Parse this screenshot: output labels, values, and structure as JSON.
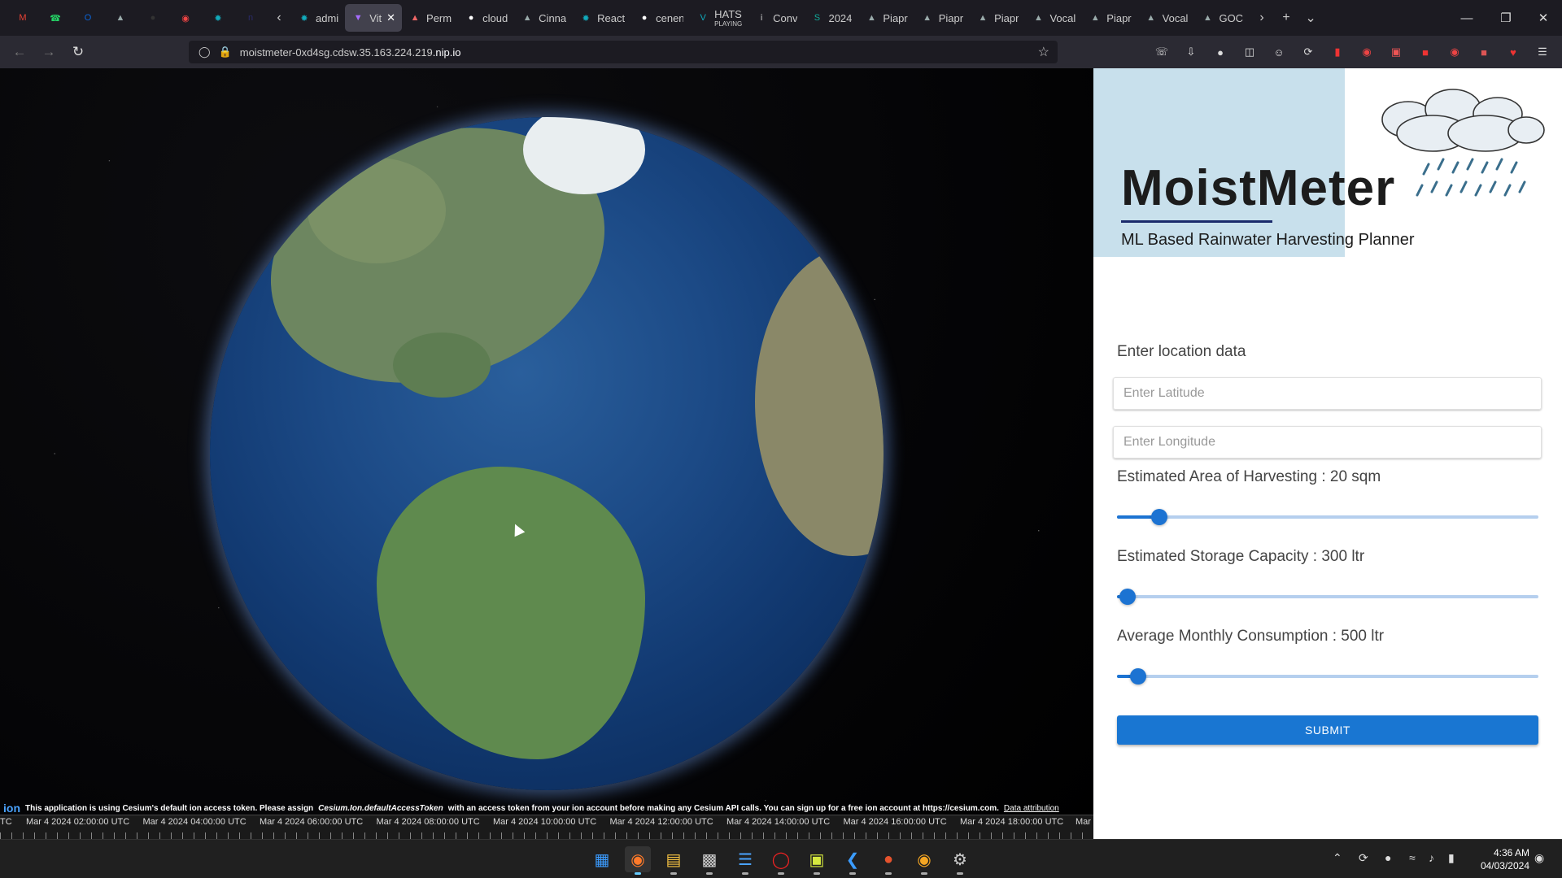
{
  "browser": {
    "tabs": [
      {
        "label": "",
        "icon": "gmail-icon",
        "color": "#ea4335"
      },
      {
        "label": "",
        "icon": "whatsapp-icon",
        "color": "#25d366"
      },
      {
        "label": "",
        "icon": "outlook-icon",
        "color": "#0a64d8"
      },
      {
        "label": "",
        "icon": "bird-icon",
        "color": "#9aa"
      },
      {
        "label": "",
        "icon": "circle-icon",
        "color": "#333"
      },
      {
        "label": "",
        "icon": "chrome-icon",
        "color": "#e44"
      },
      {
        "label": "",
        "icon": "react-icon",
        "color": "#1ab"
      },
      {
        "label": "",
        "icon": "n-icon",
        "color": "#2a2a6a"
      },
      {
        "label": "admi",
        "icon": "react-icon",
        "color": "#1ab"
      },
      {
        "label": "Vit",
        "icon": "vite-icon",
        "color": "#a66cff"
      },
      {
        "label": "Perm",
        "icon": "fire-icon",
        "color": "#e66"
      },
      {
        "label": "cloud",
        "icon": "github-icon",
        "color": "#fff"
      },
      {
        "label": "Cinna",
        "icon": "bird-icon",
        "color": "#9aa"
      },
      {
        "label": "React",
        "icon": "react-icon",
        "color": "#1ab"
      },
      {
        "label": "cenen",
        "icon": "github-icon",
        "color": "#fff"
      },
      {
        "label": "HATS",
        "sublabel": "PLAYING",
        "icon": "vimeo-icon",
        "color": "#1ab"
      },
      {
        "label": "Conv",
        "icon": "info-icon",
        "color": "#ccc"
      },
      {
        "label": "2024",
        "icon": "s-icon",
        "color": "#1a9"
      },
      {
        "label": "Piapr",
        "icon": "bird-icon",
        "color": "#9aa"
      },
      {
        "label": "Piapr",
        "icon": "bird-icon",
        "color": "#9aa"
      },
      {
        "label": "Piapr",
        "icon": "bird-icon",
        "color": "#9aa"
      },
      {
        "label": "Vocal",
        "icon": "bird-icon",
        "color": "#9aa"
      },
      {
        "label": "Piapr",
        "icon": "bird-icon",
        "color": "#9aa"
      },
      {
        "label": "Vocal",
        "icon": "bird-icon",
        "color": "#9aa"
      },
      {
        "label": "GOC",
        "icon": "bird-icon",
        "color": "#9aa"
      }
    ],
    "url_path": "moistmeter-0xd4sg.cdsw.35.163.224.219",
    "url_host": ".nip.io"
  },
  "cesium": {
    "credit_text": "This application is using Cesium's default ion access token. Please assign",
    "credit_code": "Cesium.Ion.defaultAccessToken",
    "credit_text2": "with an access token from your ion account before making any Cesium API calls. You can sign up for a free ion account at https://cesium.com.",
    "credit_link": "Data attribution",
    "ion_label": "ion",
    "timeline_start": "TC",
    "timeline_end": "Mar",
    "timeline_labels": [
      "Mar 4 2024 02:00:00 UTC",
      "Mar 4 2024 04:00:00 UTC",
      "Mar 4 2024 06:00:00 UTC",
      "Mar 4 2024 08:00:00 UTC",
      "Mar 4 2024 10:00:00 UTC",
      "Mar 4 2024 12:00:00 UTC",
      "Mar 4 2024 14:00:00 UTC",
      "Mar 4 2024 16:00:00 UTC",
      "Mar 4 2024 18:00:00 UTC"
    ]
  },
  "panel": {
    "title": "MoistMeter",
    "subtitle": "ML Based Rainwater Harvesting Planner",
    "form_label": "Enter location data",
    "latitude_placeholder": "Enter Latitude",
    "longitude_placeholder": "Enter Longitude",
    "area_label": "Estimated Area of Harvesting : 20 sqm",
    "area_fraction": 0.1,
    "storage_label": "Estimated Storage Capacity : 300 ltr",
    "storage_fraction": 0.025,
    "consumption_label": "Average Monthly Consumption : 500 ltr",
    "consumption_fraction": 0.05,
    "submit_label": "SUBMIT",
    "accent_color": "#1976d2"
  },
  "system": {
    "time": "4:36 AM",
    "date": "04/03/2024"
  }
}
